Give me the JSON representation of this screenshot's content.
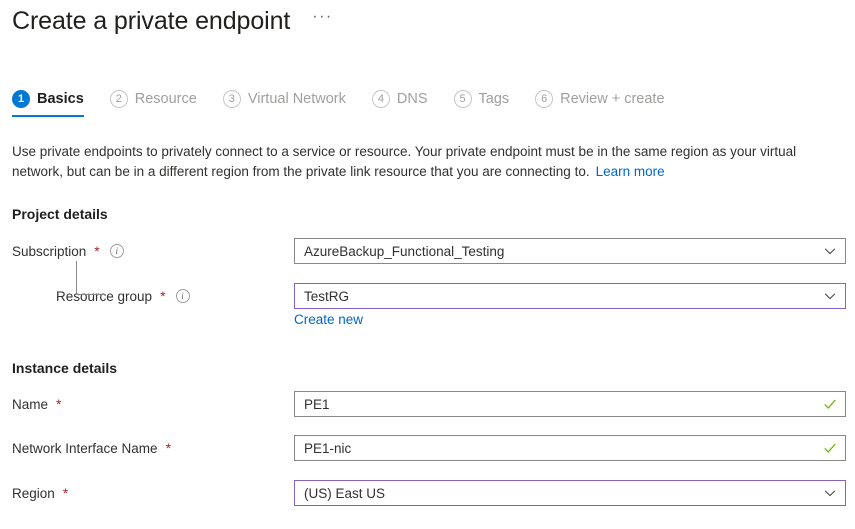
{
  "header": {
    "title": "Create a private endpoint",
    "more_label": "···"
  },
  "tabs": [
    {
      "num": "1",
      "label": "Basics",
      "active": true
    },
    {
      "num": "2",
      "label": "Resource",
      "active": false
    },
    {
      "num": "3",
      "label": "Virtual Network",
      "active": false
    },
    {
      "num": "4",
      "label": "DNS",
      "active": false
    },
    {
      "num": "5",
      "label": "Tags",
      "active": false
    },
    {
      "num": "6",
      "label": "Review + create",
      "active": false
    }
  ],
  "description": {
    "text": "Use private endpoints to privately connect to a service or resource. Your private endpoint must be in the same region as your virtual network, but can be in a different region from the private link resource that you are connecting to.",
    "link_label": "Learn more"
  },
  "project_details": {
    "heading": "Project details",
    "subscription": {
      "label": "Subscription",
      "required": "*",
      "value": "AzureBackup_Functional_Testing",
      "control": "dropdown"
    },
    "resource_group": {
      "label": "Resource group",
      "required": "*",
      "value": "TestRG",
      "control": "dropdown",
      "create_new_label": "Create new"
    }
  },
  "instance_details": {
    "heading": "Instance details",
    "name": {
      "label": "Name",
      "required": "*",
      "value": "PE1",
      "control": "text",
      "validation": "valid"
    },
    "network_interface_name": {
      "label": "Network Interface Name",
      "required": "*",
      "value": "PE1-nic",
      "control": "text",
      "validation": "valid"
    },
    "region": {
      "label": "Region",
      "required": "*",
      "value": "(US) East US",
      "control": "dropdown"
    }
  },
  "colors": {
    "accent_blue": "#0078d4",
    "link_blue": "#0066cc",
    "focus_purple": "#8661c5",
    "required_red": "#a4262c",
    "valid_green": "#6bb700",
    "border_gray": "#8a8886"
  }
}
